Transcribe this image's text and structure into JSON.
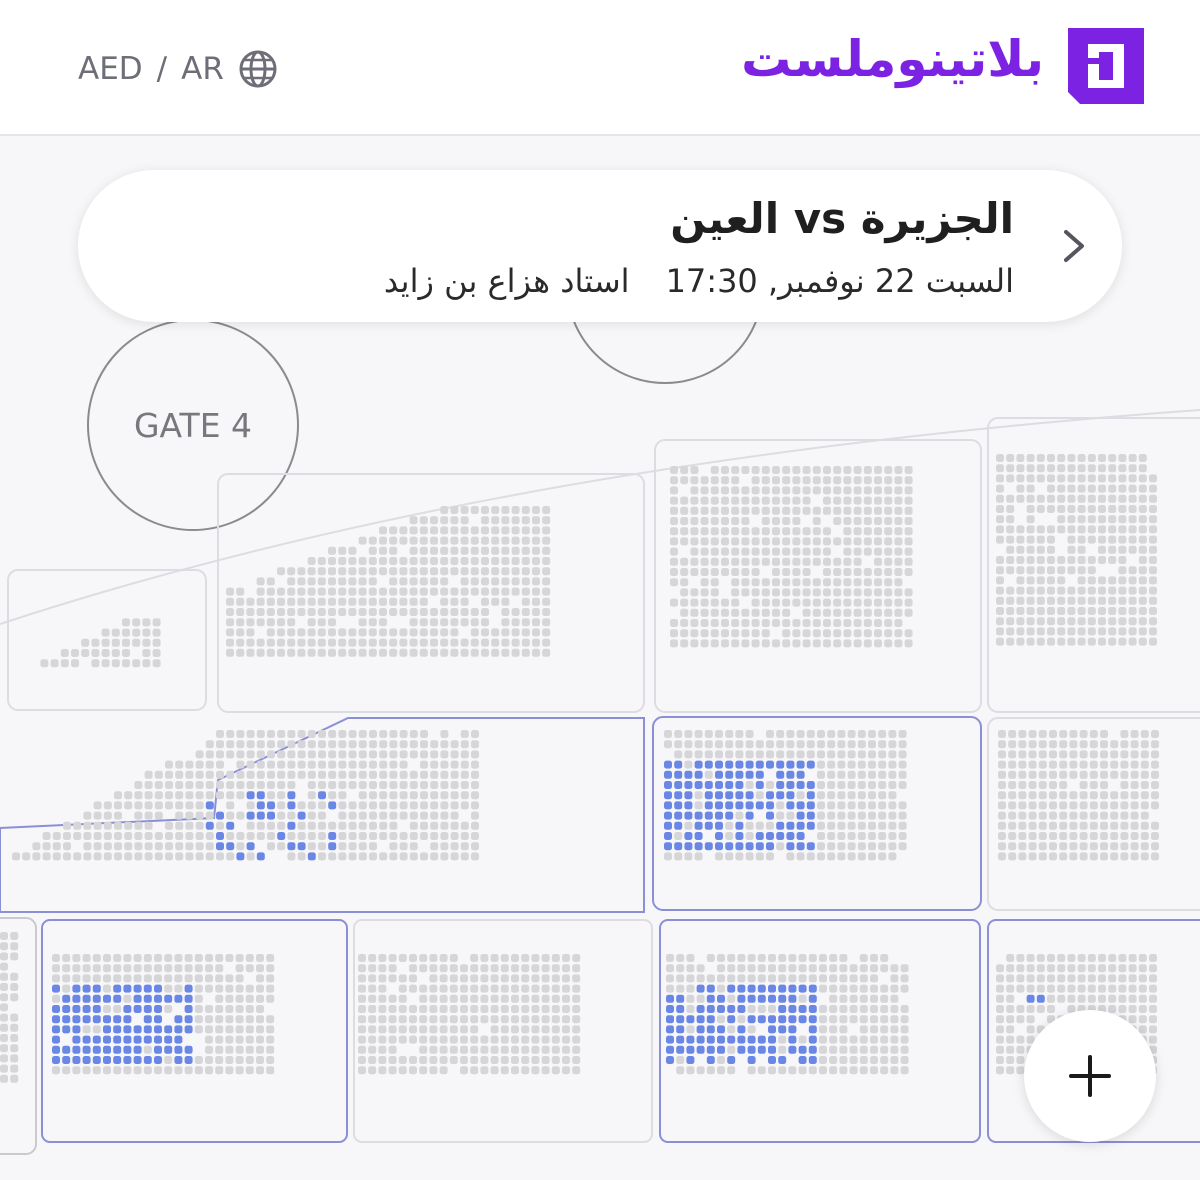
{
  "header": {
    "currency": "AED",
    "separator": "/",
    "language": "AR",
    "brand_name": "بلاتينوملست",
    "icons": {
      "language": "globe-icon",
      "logo": "platinumlist-logo-icon"
    }
  },
  "event": {
    "title": "العين vs الجزيرة",
    "date_time": "السبت 22 نوفمبر, 17:30",
    "venue": "استاد هزاع بن زايد",
    "icon": "chevron-right-icon"
  },
  "map": {
    "gate_label": "GATE 4",
    "zoom_icon": "plus-icon",
    "colors": {
      "available": "#6b87e6",
      "unavailable": "#d6d6d9",
      "section_active_border": "#8b8fd6",
      "section_border": "#dcdce2",
      "brand": "#7b22e3"
    }
  }
}
